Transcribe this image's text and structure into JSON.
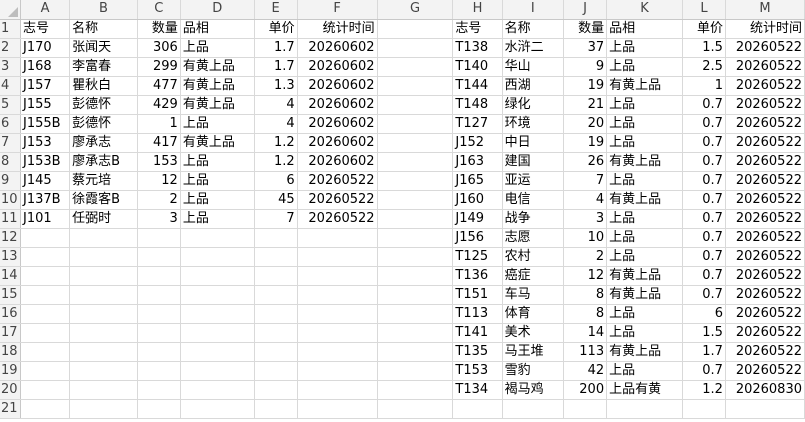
{
  "columns": [
    "A",
    "B",
    "C",
    "D",
    "E",
    "F",
    "G",
    "H",
    "I",
    "J",
    "K",
    "L",
    "M"
  ],
  "active_row": 17,
  "rows": [
    {
      "n": "1",
      "c": [
        "志号",
        "名称",
        "数量",
        "品相",
        "单价",
        "统计时间",
        "",
        "志号",
        "名称",
        "数量",
        "品相",
        "单价",
        "统计时间"
      ]
    },
    {
      "n": "2",
      "c": [
        "J170",
        "张闻天",
        "306",
        "上品",
        "1.7",
        "20260602",
        "",
        "T138",
        "水浒二",
        "37",
        "上品",
        "1.5",
        "20260522"
      ]
    },
    {
      "n": "3",
      "c": [
        "J168",
        "李富春",
        "299",
        "有黄上品",
        "1.7",
        "20260602",
        "",
        "T140",
        "华山",
        "9",
        "上品",
        "2.5",
        "20260522"
      ]
    },
    {
      "n": "4",
      "c": [
        "J157",
        "瞿秋白",
        "477",
        "有黄上品",
        "1.3",
        "20260602",
        "",
        "T144",
        "西湖",
        "19",
        "有黄上品",
        "1",
        "20260522"
      ]
    },
    {
      "n": "5",
      "c": [
        "J155",
        "彭德怀",
        "429",
        "有黄上品",
        "4",
        "20260602",
        "",
        "T148",
        "绿化",
        "21",
        "上品",
        "0.7",
        "20260522"
      ]
    },
    {
      "n": "6",
      "c": [
        "J155B",
        "彭德怀",
        "1",
        "上品",
        "4",
        "20260602",
        "",
        "T127",
        "环境",
        "20",
        "上品",
        "0.7",
        "20260522"
      ]
    },
    {
      "n": "7",
      "c": [
        "J153",
        "廖承志",
        "417",
        "有黄上品",
        "1.2",
        "20260602",
        "",
        "J152",
        "中日",
        "19",
        "上品",
        "0.7",
        "20260522"
      ]
    },
    {
      "n": "8",
      "c": [
        "J153B",
        "廖承志B",
        "153",
        "上品",
        "1.2",
        "20260602",
        "",
        "J163",
        "建国",
        "26",
        "有黄上品",
        "0.7",
        "20260522"
      ]
    },
    {
      "n": "9",
      "c": [
        "J145",
        "蔡元培",
        "12",
        "上品",
        "6",
        "20260522",
        "",
        "J165",
        "亚运",
        "7",
        "上品",
        "0.7",
        "20260522"
      ]
    },
    {
      "n": "10",
      "c": [
        "J137B",
        "徐霞客B",
        "2",
        "上品",
        "45",
        "20260522",
        "",
        "J160",
        "电信",
        "4",
        "有黄上品",
        "0.7",
        "20260522"
      ]
    },
    {
      "n": "11",
      "c": [
        "J101",
        "任弼时",
        "3",
        "上品",
        "7",
        "20260522",
        "",
        "J149",
        "战争",
        "3",
        "上品",
        "0.7",
        "20260522"
      ]
    },
    {
      "n": "12",
      "c": [
        "",
        "",
        "",
        "",
        "",
        "",
        "",
        "J156",
        "志愿",
        "10",
        "上品",
        "0.7",
        "20260522"
      ]
    },
    {
      "n": "13",
      "c": [
        "",
        "",
        "",
        "",
        "",
        "",
        "",
        "T125",
        "农村",
        "2",
        "上品",
        "0.7",
        "20260522"
      ]
    },
    {
      "n": "14",
      "c": [
        "",
        "",
        "",
        "",
        "",
        "",
        "",
        "T136",
        "癌症",
        "12",
        "有黄上品",
        "0.7",
        "20260522"
      ]
    },
    {
      "n": "15",
      "c": [
        "",
        "",
        "",
        "",
        "",
        "",
        "",
        "T151",
        "车马",
        "8",
        "有黄上品",
        "0.7",
        "20260522"
      ]
    },
    {
      "n": "16",
      "c": [
        "",
        "",
        "",
        "",
        "",
        "",
        "",
        "T113",
        "体育",
        "8",
        "上品",
        "6",
        "20260522"
      ]
    },
    {
      "n": "17",
      "c": [
        "",
        "",
        "",
        "",
        "",
        "",
        "",
        "T141",
        "美术",
        "14",
        "上品",
        "1.5",
        "20260522"
      ]
    },
    {
      "n": "18",
      "c": [
        "",
        "",
        "",
        "",
        "",
        "",
        "",
        "T135",
        "马王堆",
        "113",
        "有黄上品",
        "1.7",
        "20260522"
      ]
    },
    {
      "n": "19",
      "c": [
        "",
        "",
        "",
        "",
        "",
        "",
        "",
        "T153",
        "雪豹",
        "42",
        "上品",
        "0.7",
        "20260522"
      ]
    },
    {
      "n": "20",
      "c": [
        "",
        "",
        "",
        "",
        "",
        "",
        "",
        "T134",
        "褐马鸡",
        "200",
        "上品有黄",
        "1.2",
        "20260830"
      ]
    },
    {
      "n": "21",
      "c": [
        "",
        "",
        "",
        "",
        "",
        "",
        "",
        "",
        "",
        "",
        "",
        "",
        ""
      ]
    }
  ]
}
